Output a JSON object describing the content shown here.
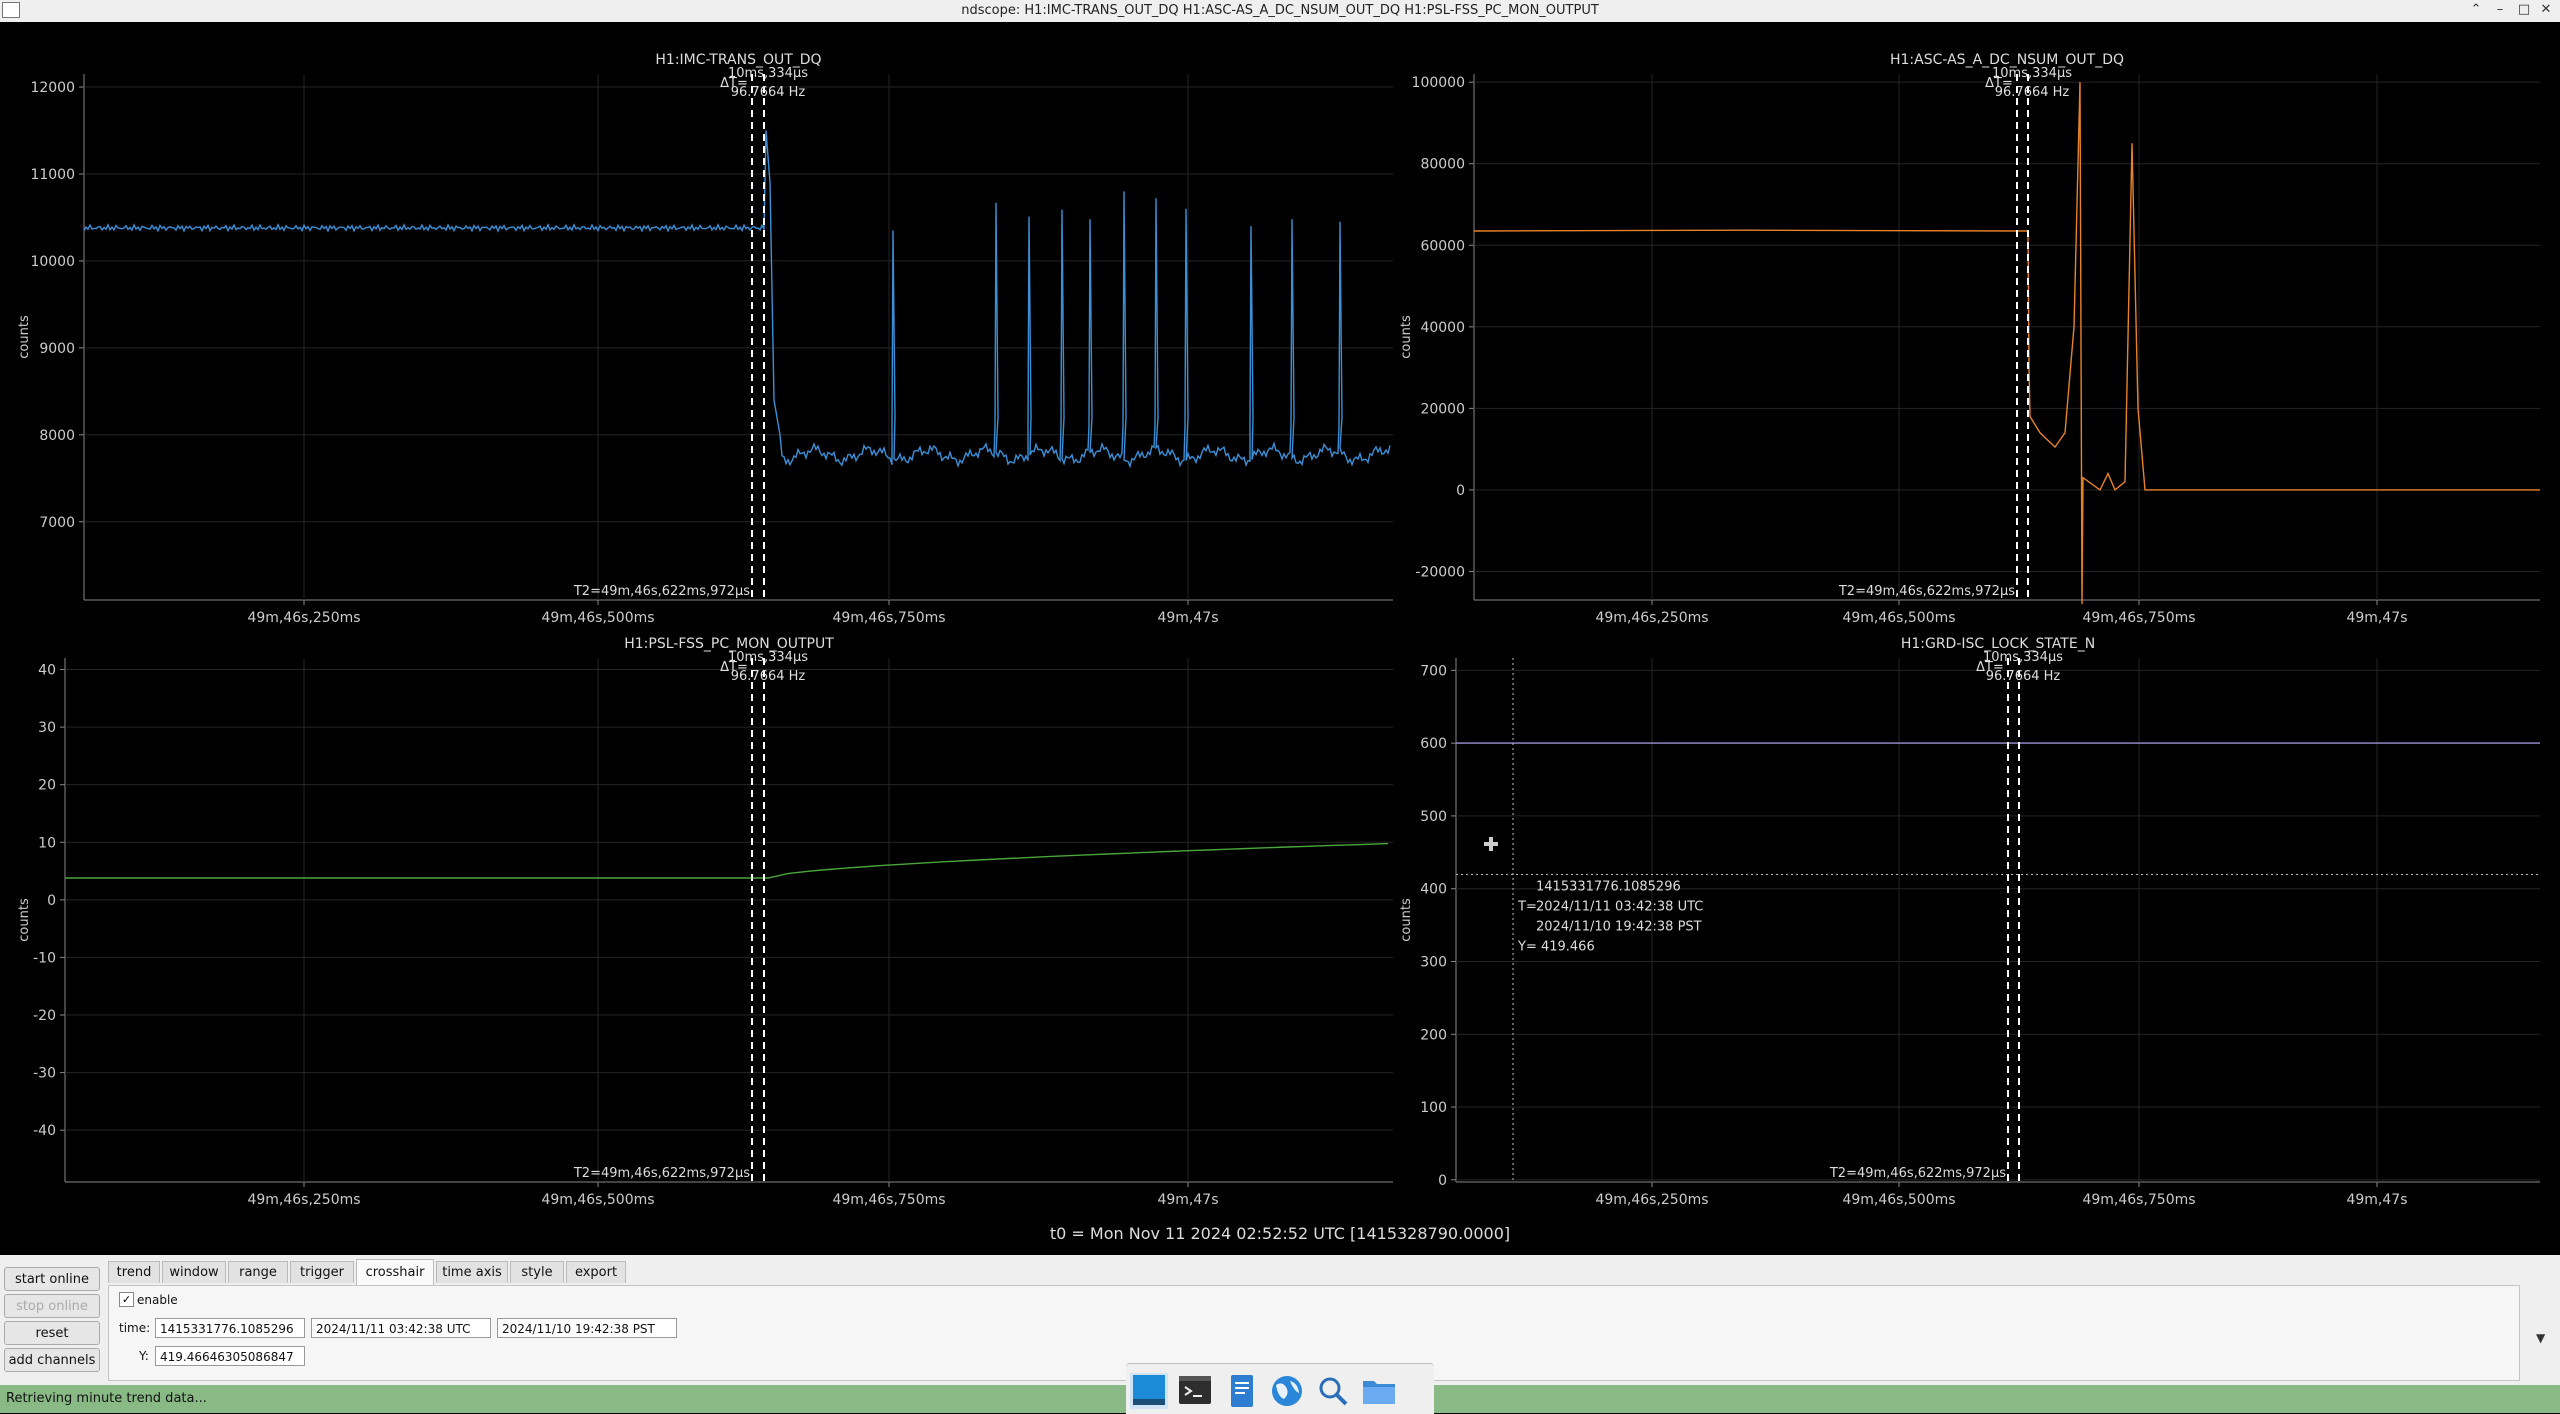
{
  "window": {
    "title": "ndscope: H1:IMC-TRANS_OUT_DQ H1:ASC-AS_A_DC_NSUM_OUT_DQ H1:PSL-FSS_PC_MON_OUTPUT",
    "minimize": "–",
    "maximize": "□",
    "close": "✕",
    "restore": "⌃"
  },
  "colors": {
    "background": "#000000",
    "grid": "#242424",
    "trace_blue": "#3a8fd6",
    "trace_orange": "#e8822a",
    "trace_green": "#4aa53c",
    "trace_purple": "#9e8fd6",
    "status_bar": "#89ba86"
  },
  "cursor_common": {
    "dt_label": "ΔT=",
    "dt_value": "10ms,334μs",
    "dt_freq": "96.7664 Hz",
    "t2_label": "T2=49m,46s,622ms,972μs"
  },
  "chart_data": [
    {
      "type": "line",
      "title": "H1:IMC-TRANS_OUT_DQ",
      "ylabel": "counts",
      "x_ticks": [
        "49m,46s,250ms",
        "49m,46s,500ms",
        "49m,46s,750ms",
        "49m,47s"
      ],
      "y_ticks": [
        7000,
        8000,
        9000,
        10000,
        11000,
        12000
      ],
      "ylim": [
        6100,
        12150
      ],
      "grid": true,
      "series": [
        {
          "color": "trace_blue",
          "pre_level": 10380,
          "jump_peak": 11500,
          "post_level": 7770,
          "spike_peaks": [
            10350,
            10670,
            10510,
            10590,
            10480,
            10800,
            10720,
            10600,
            10400,
            10480,
            10450
          ]
        }
      ]
    },
    {
      "type": "line",
      "title": "H1:ASC-AS_A_DC_NSUM_OUT_DQ",
      "ylabel": "counts",
      "x_ticks": [
        "49m,46s,250ms",
        "49m,46s,500ms",
        "49m,46s,750ms",
        "49m,47s"
      ],
      "y_ticks": [
        -20000,
        0,
        20000,
        40000,
        60000,
        80000,
        100000
      ],
      "ylim": [
        -27000,
        102000
      ],
      "grid": true,
      "series": [
        {
          "color": "trace_orange",
          "pre_level": 63500,
          "drop_level": 18000,
          "min_level": 10500,
          "peak_1": 100000,
          "peak_2": 85000,
          "post_level": 0
        }
      ]
    },
    {
      "type": "line",
      "title": "H1:PSL-FSS_PC_MON_OUTPUT",
      "ylabel": "counts",
      "x_ticks": [
        "49m,46s,250ms",
        "49m,46s,500ms",
        "49m,46s,750ms",
        "49m,47s"
      ],
      "y_ticks": [
        -40,
        -30,
        -20,
        -10,
        0,
        10,
        20,
        30,
        40
      ],
      "ylim": [
        -49,
        42
      ],
      "grid": true,
      "series": [
        {
          "color": "trace_green",
          "pre_level": 3.8,
          "end_level": 9.8
        }
      ]
    },
    {
      "type": "line",
      "title": "H1:GRD-ISC_LOCK_STATE_N",
      "ylabel": "counts",
      "x_ticks": [
        "49m,46s,250ms",
        "49m,46s,500ms",
        "49m,46s,750ms",
        "49m,47s"
      ],
      "y_ticks": [
        0,
        100,
        200,
        300,
        400,
        500,
        600,
        700
      ],
      "ylim": [
        -3,
        717
      ],
      "grid": true,
      "series": [
        {
          "color": "trace_purple",
          "level": 600
        }
      ],
      "crosshair": {
        "y": 419.466,
        "gps": "1415331776.1085296",
        "t_label": "T=",
        "utc": "2024/11/11 03:42:38 UTC",
        "pst": "2024/11/10 19:42:38 PST",
        "y_label": "Y= 419.466"
      }
    }
  ],
  "t0_label": "t0 = Mon Nov 11 2024 02:52:52 UTC [1415328790.0000]",
  "side_buttons": {
    "start_online": "start online",
    "stop_online": "stop online",
    "reset": "reset",
    "add_channels": "add channels"
  },
  "tabs": [
    {
      "label": "trend"
    },
    {
      "label": "window"
    },
    {
      "label": "range"
    },
    {
      "label": "trigger"
    },
    {
      "label": "crosshair"
    },
    {
      "label": "time axis"
    },
    {
      "label": "style"
    },
    {
      "label": "export"
    }
  ],
  "active_tab": "crosshair",
  "crosshair_panel": {
    "enable_check": "✓",
    "enable_label": "enable",
    "time_label": "time:",
    "time_gps": "1415331776.1085296",
    "time_utc": "2024/11/11 03:42:38 UTC",
    "time_pst": "2024/11/10 19:42:38 PST",
    "y_label": "Y:",
    "y_value": "419.46646305086847",
    "collapse_arrow": "▼"
  },
  "status_text": "Retrieving minute trend data...",
  "taskbar_icons": [
    "desktop-icon",
    "terminal-icon",
    "text-editor-icon",
    "web-browser-icon",
    "search-icon",
    "file-manager-icon"
  ]
}
